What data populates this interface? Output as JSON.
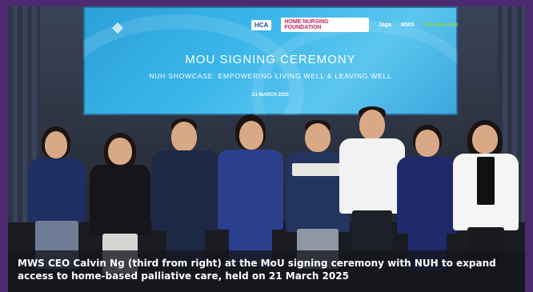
{
  "screen": {
    "logos": [
      "HCA",
      "HOME NURSING FOUNDATION",
      "Jaga",
      "MWS",
      "Mountbatten"
    ],
    "title": "MOU SIGNING CEREMONY",
    "subtitle": "NUH SHOWCASE: EMPOWERING LIVING WELL & LEAVING WELL",
    "date": "21 MARCH 2025"
  },
  "caption": {
    "line1": "MWS CEO Calvin Ng (third from right) at the MoU signing ceremony with NUH to expand",
    "line2": "access to home-based palliative care, held on 21 March 2025"
  },
  "colors": {
    "frame": "#4b2a70",
    "screen": "#3bb6ea",
    "caption_bg": "#14161c"
  }
}
